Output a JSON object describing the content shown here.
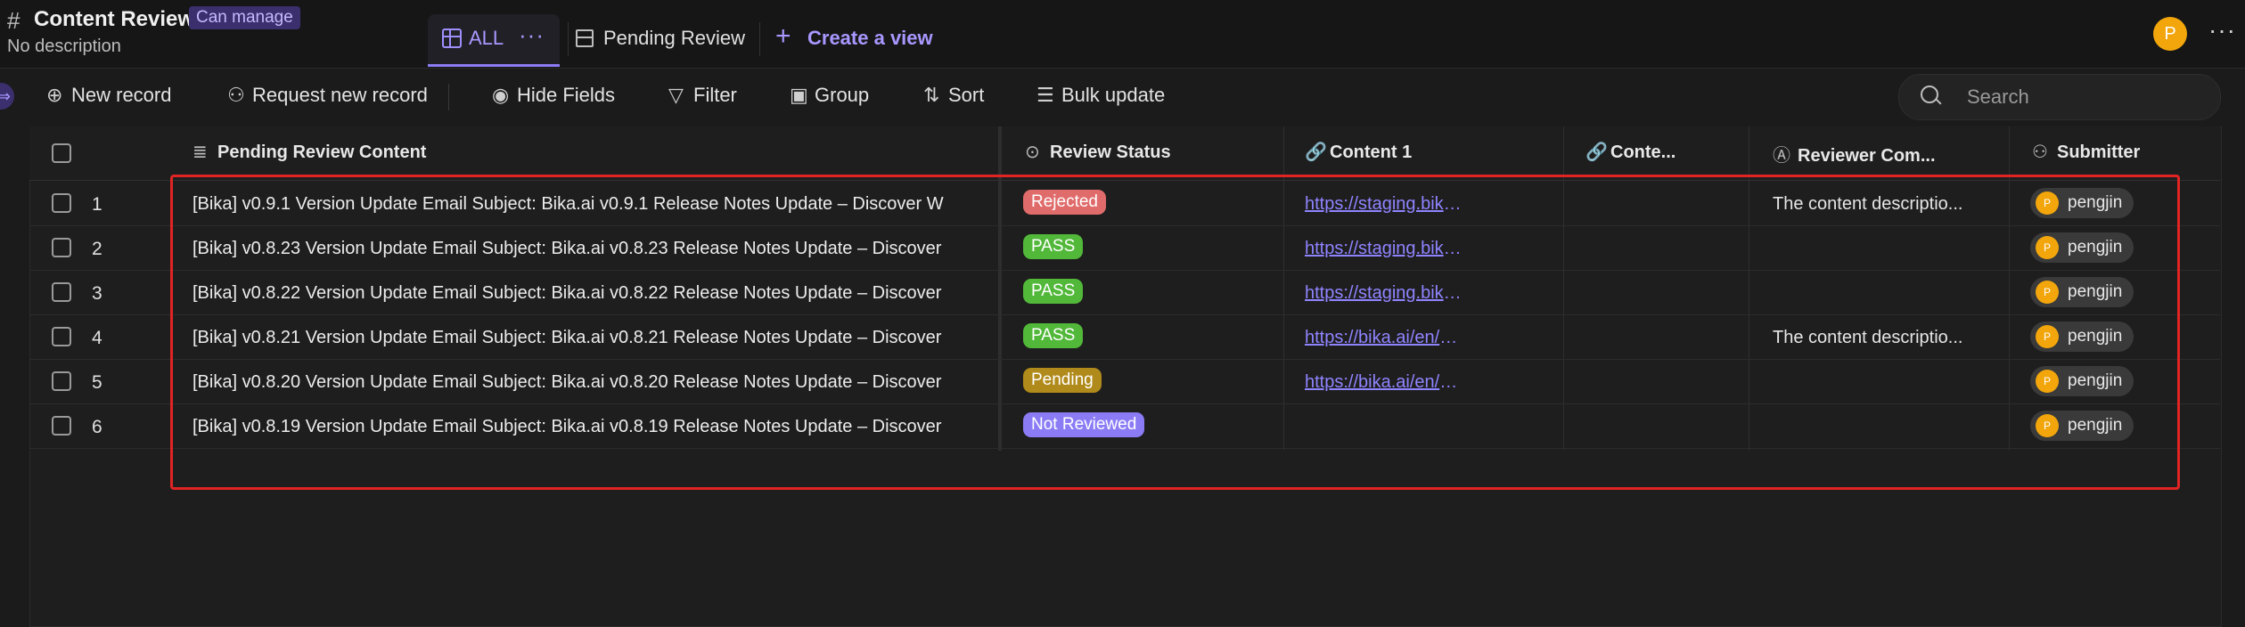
{
  "header": {
    "title": "Content Review",
    "permission_badge": "Can manage",
    "description": "No description",
    "avatar_initial": "P"
  },
  "tabs": [
    {
      "label": "ALL",
      "more": "···"
    },
    {
      "label": "Pending Review"
    }
  ],
  "create_view_label": "Create a view",
  "toolbar": {
    "new_record": "New record",
    "request_new_record": "Request new record",
    "hide_fields": "Hide Fields",
    "filter": "Filter",
    "group": "Group",
    "sort": "Sort",
    "bulk_update": "Bulk update",
    "search_placeholder": "Search"
  },
  "columns": [
    "Pending Review Content",
    "Review Status",
    "Content 1",
    "Conte...",
    "Reviewer Com...",
    "Submitter"
  ],
  "rows": [
    {
      "num": "1",
      "content": "[Bika] v0.9.1 Version Update Email Subject: Bika.ai v0.9.1 Release Notes Update – Discover W",
      "status": "Rejected",
      "status_color": "#e06b6b",
      "link": "https://staging.bika.ai/en/...",
      "comment": "The content descriptio...",
      "submitter": "pengjin",
      "avatar": "P"
    },
    {
      "num": "2",
      "content": "[Bika] v0.8.23 Version Update Email Subject: Bika.ai v0.8.23 Release Notes Update – Discover",
      "status": "PASS",
      "status_color": "#52b83a",
      "link": "https://staging.bika.ai/en/...",
      "comment": "",
      "submitter": "pengjin",
      "avatar": "P"
    },
    {
      "num": "3",
      "content": "[Bika] v0.8.22 Version Update Email Subject: Bika.ai v0.8.22 Release Notes Update – Discover",
      "status": "PASS",
      "status_color": "#52b83a",
      "link": "https://staging.bika.ai/en/...",
      "comment": "",
      "submitter": "pengjin",
      "avatar": "P"
    },
    {
      "num": "4",
      "content": "[Bika] v0.8.21 Version Update Email Subject: Bika.ai v0.8.21 Release Notes Update – Discover",
      "status": "PASS",
      "status_color": "#52b83a",
      "link": "https://bika.ai/en/help/rel...",
      "comment": "The content descriptio...",
      "submitter": "pengjin",
      "avatar": "P"
    },
    {
      "num": "5",
      "content": "[Bika] v0.8.20 Version Update Email Subject: Bika.ai v0.8.20 Release Notes Update – Discover",
      "status": "Pending",
      "status_color": "#b08a1a",
      "link": "https://bika.ai/en/help/rel...",
      "comment": "",
      "submitter": "pengjin",
      "avatar": "P"
    },
    {
      "num": "6",
      "content": "[Bika] v0.8.19 Version Update Email Subject: Bika.ai v0.8.19 Release Notes Update – Discover",
      "status": "Not Reviewed",
      "status_color": "#8b7cf6",
      "link": "",
      "comment": "",
      "submitter": "pengjin",
      "avatar": "P"
    }
  ]
}
